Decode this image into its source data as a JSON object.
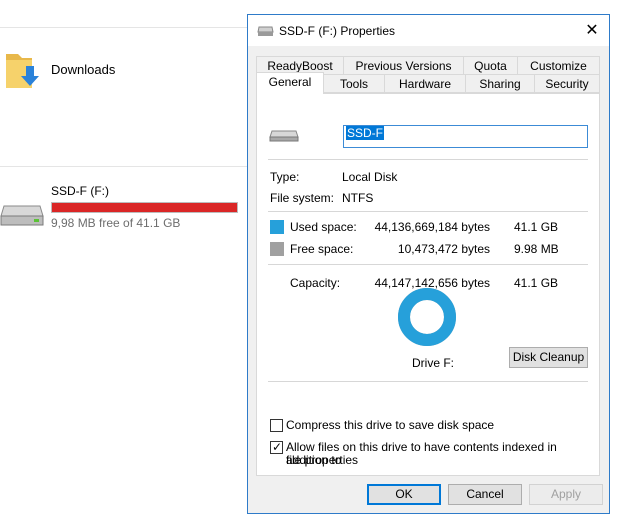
{
  "explorer": {
    "folder_label": "Downloads",
    "drive": {
      "name": "SSD-F (F:)",
      "free_text": "9,98 MB free of 41.1 GB",
      "used_fraction": 0.9998
    }
  },
  "dialog": {
    "title": "SSD-F (F:) Properties",
    "close_glyph": "✕",
    "tabs_row1": [
      "ReadyBoost",
      "Previous Versions",
      "Quota",
      "Customize"
    ],
    "tabs_row2": [
      "General",
      "Tools",
      "Hardware",
      "Sharing",
      "Security"
    ],
    "active_tab": "General",
    "name_value": "SSD-F",
    "type_label": "Type:",
    "type_value": "Local Disk",
    "fs_label": "File system:",
    "fs_value": "NTFS",
    "used_label": "Used space:",
    "used_bytes": "44,136,669,184 bytes",
    "used_size": "41.1 GB",
    "free_label": "Free space:",
    "free_bytes": "10,473,472 bytes",
    "free_size": "9.98 MB",
    "capacity_label": "Capacity:",
    "capacity_bytes": "44,147,142,656 bytes",
    "capacity_size": "41.1 GB",
    "drive_label": "Drive F:",
    "cleanup_label": "Disk Cleanup",
    "compress_label": "Compress this drive to save disk space",
    "compress_checked": false,
    "index_label_1": "Allow files on this drive to have contents indexed in addition to",
    "index_label_2": "file properties",
    "index_checked": true,
    "ok_label": "OK",
    "cancel_label": "Cancel",
    "apply_label": "Apply"
  },
  "colors": {
    "used": "#26a0da",
    "free": "#a0a0a0",
    "explorer_bar": "#da2626",
    "accent": "#0078d7"
  }
}
